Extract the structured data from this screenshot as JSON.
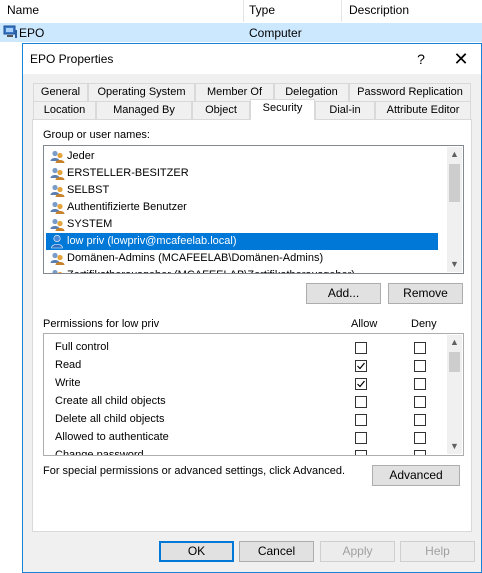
{
  "background": {
    "columns": [
      "Name",
      "Type",
      "Description"
    ],
    "row": {
      "name": "EPO",
      "type": "Computer"
    }
  },
  "dialog": {
    "title": "EPO Properties",
    "help_glyph": "?",
    "close_glyph": "✕",
    "tabs_row1": [
      "General",
      "Operating System",
      "Member Of",
      "Delegation",
      "Password Replication"
    ],
    "tabs_row2": [
      "Location",
      "Managed By",
      "Object",
      "Security",
      "Dial-in",
      "Attribute Editor"
    ],
    "active_tab": "Security",
    "group_label": "Group or user names:",
    "users": [
      {
        "name": "Jeder"
      },
      {
        "name": "ERSTELLER-BESITZER"
      },
      {
        "name": "SELBST"
      },
      {
        "name": "Authentifizierte Benutzer"
      },
      {
        "name": "SYSTEM"
      },
      {
        "name": "low priv (lowpriv@mcafeelab.local)",
        "selected": true
      },
      {
        "name": "Domänen-Admins (MCAFEELAB\\Domänen-Admins)"
      },
      {
        "name": "Zertifikatherausgeber (MCAFEELAB\\Zertifikatherausgeber)"
      }
    ],
    "add_button": "Add...",
    "remove_button": "Remove",
    "permissions_label": "Permissions for low priv",
    "allow_header": "Allow",
    "deny_header": "Deny",
    "permissions": [
      {
        "name": "Full control",
        "allow": false,
        "deny": false
      },
      {
        "name": "Read",
        "allow": true,
        "deny": false
      },
      {
        "name": "Write",
        "allow": true,
        "deny": false
      },
      {
        "name": "Create all child objects",
        "allow": false,
        "deny": false
      },
      {
        "name": "Delete all child objects",
        "allow": false,
        "deny": false
      },
      {
        "name": "Allowed to authenticate",
        "allow": false,
        "deny": false
      },
      {
        "name": "Change password",
        "allow": false,
        "deny": false
      }
    ],
    "advanced_text": "For special permissions or advanced settings, click Advanced.",
    "advanced_button": "Advanced",
    "ok_button": "OK",
    "cancel_button": "Cancel",
    "apply_button": "Apply",
    "help_button": "Help",
    "colors": {
      "selection": "#0078d7",
      "accent_border": "#1883d7"
    }
  }
}
